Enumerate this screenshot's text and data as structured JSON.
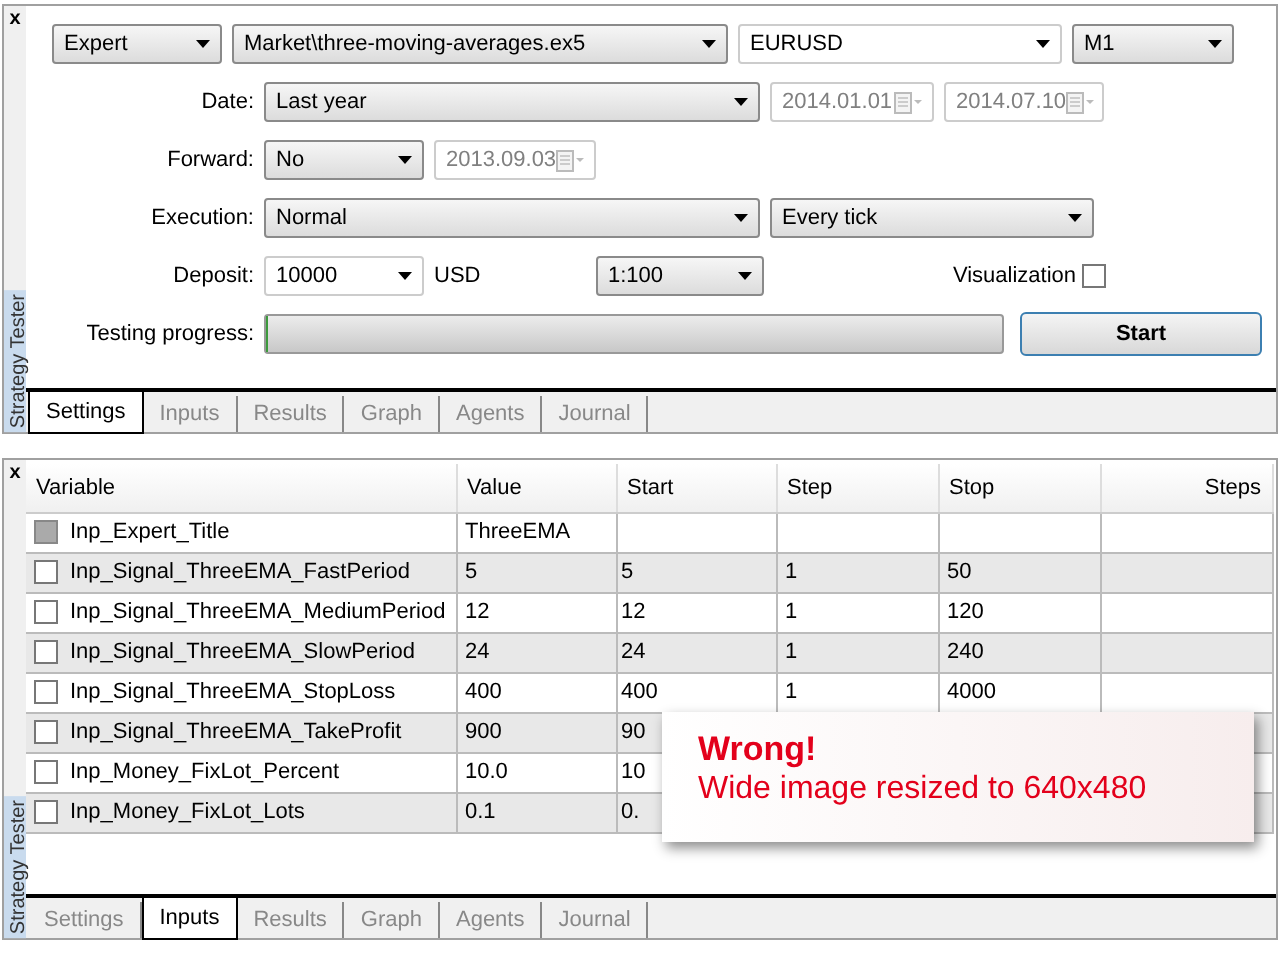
{
  "settings_panel": {
    "close": "x",
    "side_title": "Strategy Tester",
    "rows": [
      {
        "label": null,
        "controls": [
          {
            "kind": "dropdown",
            "value": "Expert"
          },
          {
            "kind": "dropdown",
            "value": "Market\\three-moving-averages.ex5"
          },
          {
            "kind": "combo",
            "value": "EURUSD"
          },
          {
            "kind": "dropdown",
            "value": "M1"
          }
        ]
      },
      {
        "label": "Date:",
        "controls": [
          {
            "kind": "dropdown",
            "value": "Last year"
          },
          {
            "kind": "date",
            "value": "2014.01.01",
            "disabled": true
          },
          {
            "kind": "date",
            "value": "2014.07.10",
            "disabled": true
          }
        ]
      },
      {
        "label": "Forward:",
        "controls": [
          {
            "kind": "dropdown",
            "value": "No"
          },
          {
            "kind": "date",
            "value": "2013.09.03",
            "disabled": true
          }
        ]
      },
      {
        "label": "Execution:",
        "controls": [
          {
            "kind": "dropdown",
            "value": "Normal"
          },
          {
            "kind": "dropdown",
            "value": "Every tick"
          }
        ]
      },
      {
        "label": "Deposit:",
        "controls": [
          {
            "kind": "combo",
            "value": "10000"
          },
          {
            "kind": "text",
            "value": "USD"
          },
          {
            "kind": "dropdown",
            "value": "1:100"
          },
          {
            "kind": "checkbox",
            "value": "Visualization",
            "checked": false
          }
        ]
      },
      {
        "label": "Testing progress:",
        "controls": [
          {
            "kind": "progress",
            "level": 0
          },
          {
            "kind": "button",
            "value": "Start"
          }
        ]
      }
    ],
    "tabs": [
      {
        "label": "Settings",
        "selected": true
      },
      {
        "label": "Inputs",
        "selected": false
      },
      {
        "label": "Results",
        "selected": false
      },
      {
        "label": "Graph",
        "selected": false
      },
      {
        "label": "Agents",
        "selected": false
      },
      {
        "label": "Journal",
        "selected": false
      }
    ]
  },
  "inputs_panel": {
    "close": "x",
    "side_title": "Strategy Tester",
    "columns": [
      "Variable",
      "Value",
      "Start",
      "Step",
      "Stop",
      "Steps"
    ],
    "rows": [
      {
        "variable": "Inp_Expert_Title",
        "checked": false,
        "disabled": true,
        "value": "ThreeEMA"
      },
      {
        "variable": "Inp_Signal_ThreeEMA_FastPeriod",
        "checked": false,
        "disabled": false,
        "value": "5",
        "start": "5",
        "step": "1",
        "stop": "50"
      },
      {
        "variable": "Inp_Signal_ThreeEMA_MediumPeriod",
        "checked": false,
        "disabled": false,
        "value": "12",
        "start": "12",
        "step": "1",
        "stop": "120"
      },
      {
        "variable": "Inp_Signal_ThreeEMA_SlowPeriod",
        "checked": false,
        "disabled": false,
        "value": "24",
        "start": "24",
        "step": "1",
        "stop": "240"
      },
      {
        "variable": "Inp_Signal_ThreeEMA_StopLoss",
        "checked": false,
        "disabled": false,
        "value": "400",
        "start": "400",
        "step": "1",
        "stop": "4000"
      },
      {
        "variable": "Inp_Signal_ThreeEMA_TakeProfit",
        "checked": false,
        "disabled": false,
        "value": "900",
        "start": "90"
      },
      {
        "variable": "Inp_Money_FixLot_Percent",
        "checked": false,
        "disabled": false,
        "value": "10.0",
        "start": "10"
      },
      {
        "variable": "Inp_Money_FixLot_Lots",
        "checked": false,
        "disabled": false,
        "value": "0.1",
        "start": "0."
      }
    ],
    "tabs": [
      {
        "label": "Settings",
        "selected": false
      },
      {
        "label": "Inputs",
        "selected": true
      },
      {
        "label": "Results",
        "selected": false
      },
      {
        "label": "Graph",
        "selected": false
      },
      {
        "label": "Agents",
        "selected": false
      },
      {
        "label": "Journal",
        "selected": false
      }
    ],
    "callout": {
      "title": "Wrong!",
      "message": "Wide image resized to 640x480"
    }
  }
}
